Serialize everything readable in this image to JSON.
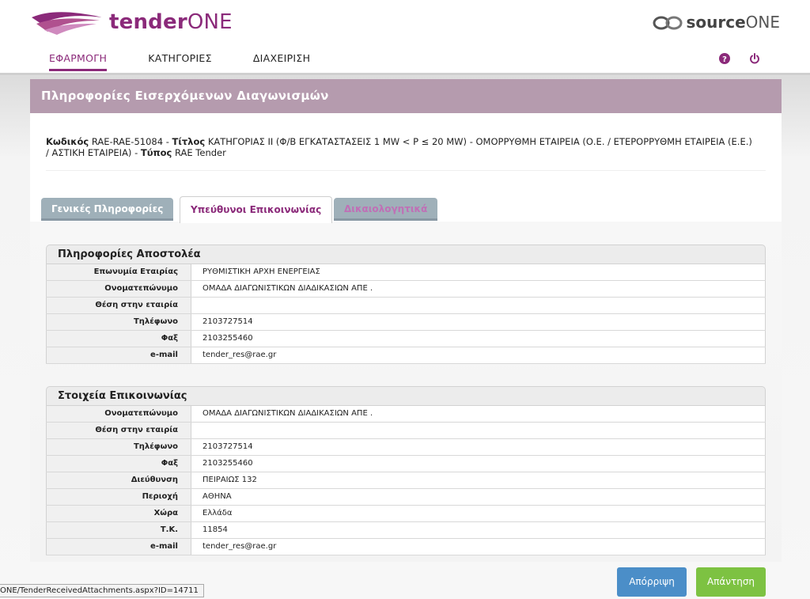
{
  "header": {
    "logo_bold": "tender",
    "logo_light": "ONE",
    "brand2_bold": "source",
    "brand2_light": "ONE"
  },
  "nav": {
    "items": [
      {
        "label": "ΕΦΑΡΜΟΓΗ",
        "active": true
      },
      {
        "label": "ΚΑΤΗΓΟΡΙΕΣ",
        "active": false
      },
      {
        "label": "ΔΙΑΧΕΙΡΙΣΗ",
        "active": false
      }
    ],
    "icons": [
      "help-icon",
      "power-icon"
    ]
  },
  "panel": {
    "title": "Πληροφορίες Εισερχόμενων Διαγωνισμών"
  },
  "summary": {
    "code_label": "Κωδικός",
    "code_value": "RAE-RAE-51084 -",
    "title_label": "Τίτλος",
    "title_value": "ΚΑΤΗΓΟΡΙΑΣ ΙΙ (Φ/Β ΕΓΚΑΤΑΣΤΑΣΕΙΣ 1 MW < P ≤ 20 MW) - ΟΜΟΡΡΥΘΜΗ ΕΤΑΙΡΕΙΑ (Ο.Ε. / ΕΤΕΡΟΡΡΥΘΜΗ ΕΤΑΙΡΕΙΑ (Ε.Ε.) / ΑΣΤΙΚΗ ΕΤΑΙΡΕΙΑ) -",
    "type_label": "Τύπος",
    "type_value": "RAE Tender"
  },
  "tabs": [
    {
      "label": "Γενικές Πληροφορίες"
    },
    {
      "label": "Υπεύθυνοι Επικοινωνίας"
    },
    {
      "label": "Δικαιολογητικά"
    }
  ],
  "sender": {
    "title": "Πληροφορίες Αποστολέα",
    "rows": [
      {
        "label": "Επωνυμία Εταιρίας",
        "value": "ΡΥΘΜΙΣΤΙΚΗ ΑΡΧΗ ΕΝΕΡΓΕΙΑΣ"
      },
      {
        "label": "Ονοματεπώνυμο",
        "value": "ΟΜΑΔΑ ΔΙΑΓΩΝΙΣΤΙΚΩΝ ΔΙΑΔΙΚΑΣΙΩΝ ΑΠΕ ."
      },
      {
        "label": "Θέση στην εταιρία",
        "value": ""
      },
      {
        "label": "Τηλέφωνο",
        "value": "2103727514"
      },
      {
        "label": "Φαξ",
        "value": "2103255460"
      },
      {
        "label": "e-mail",
        "value": "tender_res@rae.gr"
      }
    ]
  },
  "contact": {
    "title": "Στοιχεία Επικοινωνίας",
    "rows": [
      {
        "label": "Ονοματεπώνυμο",
        "value": "ΟΜΑΔΑ ΔΙΑΓΩΝΙΣΤΙΚΩΝ ΔΙΑΔΙΚΑΣΙΩΝ ΑΠΕ ."
      },
      {
        "label": "Θέση στην εταιρία",
        "value": ""
      },
      {
        "label": "Τηλέφωνο",
        "value": "2103727514"
      },
      {
        "label": "Φαξ",
        "value": "2103255460"
      },
      {
        "label": "Διεύθυνση",
        "value": "ΠΕΙΡΑΙΩΣ 132"
      },
      {
        "label": "Περιοχή",
        "value": "ΑΘΗΝΑ"
      },
      {
        "label": "Χώρα",
        "value": "Ελλάδα"
      },
      {
        "label": "Τ.Κ.",
        "value": "11854"
      },
      {
        "label": "e-mail",
        "value": "tender_res@rae.gr"
      }
    ]
  },
  "actions": {
    "reject_label": "Απόρριψη",
    "answer_label": "Απάντηση"
  },
  "statusbar": {
    "url": "ONE/TenderReceivedAttachments.aspx?ID=14711"
  },
  "colors": {
    "brand": "#8b2a7a",
    "title_bar": "#b59bae",
    "reject": "#4b8ec8",
    "answer": "#7dc242"
  }
}
